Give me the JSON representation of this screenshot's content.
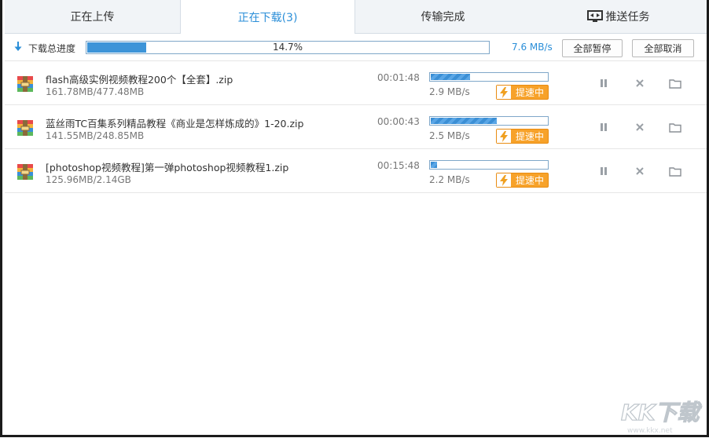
{
  "tabs": [
    {
      "label": "正在上传"
    },
    {
      "label": "正在下载(3)"
    },
    {
      "label": "传输完成"
    },
    {
      "label": "推送任务",
      "icon": "push-screen-icon"
    }
  ],
  "summary": {
    "label": "下载总进度",
    "percent_text": "14.7%",
    "percent": 14.7,
    "speed": "7.6 MB/s",
    "pause_all": "全部暂停",
    "cancel_all": "全部取消"
  },
  "downloads": [
    {
      "name": "flash高级实例视频教程200个【全套】.zip",
      "size": "161.78MB/477.48MB",
      "time": "00:01:48",
      "speed": "2.9 MB/s",
      "progress": 0.339,
      "boost": "提速中"
    },
    {
      "name": "蓝丝雨TC百集系列精品教程《商业是怎样炼成的》1-20.zip",
      "size": "141.55MB/248.85MB",
      "time": "00:00:43",
      "speed": "2.5 MB/s",
      "progress": 0.569,
      "boost": "提速中"
    },
    {
      "name": "[photoshop视频教程]第一弹photoshop视频教程1.zip",
      "size": "125.96MB/2.14GB",
      "time": "00:15:48",
      "speed": "2.2 MB/s",
      "progress": 0.057,
      "boost": "提速中"
    }
  ],
  "colors": {
    "accent": "#2a8ed8",
    "boost": "#f7a22a"
  },
  "watermark": "KK下载"
}
